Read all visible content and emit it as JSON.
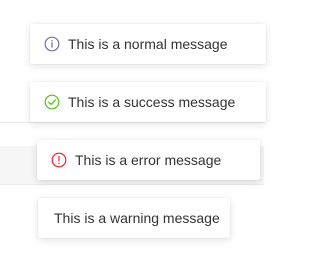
{
  "messages": [
    {
      "text": "This is a normal message",
      "icon": "info-circle-icon",
      "color": "#6b6fa8"
    },
    {
      "text": "This is a success message",
      "icon": "check-circle-icon",
      "color": "#52c41a"
    },
    {
      "text": "This is a error message",
      "icon": "exclamation-circle-icon",
      "color": "#f5222d"
    },
    {
      "text": "This is a warning message",
      "icon": "none"
    }
  ]
}
